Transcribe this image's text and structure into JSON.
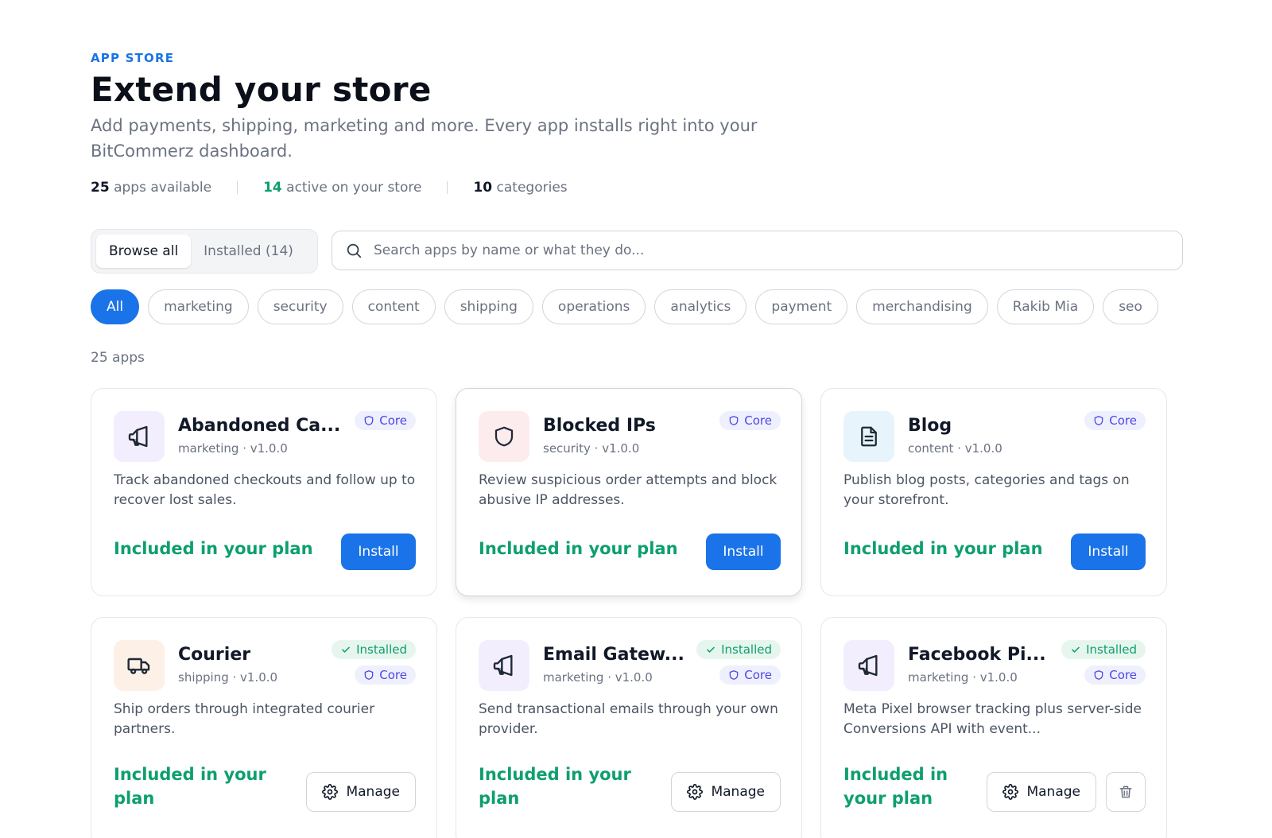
{
  "header": {
    "eyebrow": "APP STORE",
    "title": "Extend your store",
    "subtitle": "Add payments, shipping, marketing and more. Every app installs right into your BitCommerz dashboard."
  },
  "stats": [
    {
      "value": "25",
      "label": "apps available"
    },
    {
      "value": "14",
      "label": "active on your store"
    },
    {
      "value": "10",
      "label": "categories"
    }
  ],
  "tabs": [
    {
      "label": "Browse all",
      "active": true
    },
    {
      "label": "Installed (14)",
      "active": false
    }
  ],
  "search": {
    "placeholder": "Search apps by name or what they do..."
  },
  "filters": [
    "All",
    "marketing",
    "security",
    "content",
    "shipping",
    "operations",
    "analytics",
    "payment",
    "merchandising",
    "Rakib Mia",
    "seo"
  ],
  "results_count": "25 apps",
  "labels": {
    "core": "Core",
    "installed": "Installed",
    "install": "Install",
    "manage": "Manage",
    "plan": "Included in your plan"
  },
  "apps": [
    {
      "name": "Abandoned Ca...",
      "meta": "marketing · v1.0.0",
      "desc": "Track abandoned checkouts and follow up to recover lost sales.",
      "icon": "megaphone-icon"
    },
    {
      "name": "Blocked IPs",
      "meta": "security · v1.0.0",
      "desc": "Review suspicious order attempts and block abusive IP addresses.",
      "icon": "shield-icon"
    },
    {
      "name": "Blog",
      "meta": "content · v1.0.0",
      "desc": "Publish blog posts, categories and tags on your storefront.",
      "icon": "document-icon"
    },
    {
      "name": "Courier",
      "meta": "shipping · v1.0.0",
      "desc": "Ship orders through integrated courier partners.",
      "icon": "truck-icon"
    },
    {
      "name": "Email Gatew...",
      "meta": "marketing · v1.0.0",
      "desc": "Send transactional emails through your own provider.",
      "icon": "megaphone-icon"
    },
    {
      "name": "Facebook Pi...",
      "meta": "marketing · v1.0.0",
      "desc": "Meta Pixel browser tracking plus server-side Conversions API with event...",
      "icon": "megaphone-icon"
    }
  ],
  "colors": {
    "accent": "#1a73e8",
    "success": "#0e9f6e",
    "core": "#4f46e5"
  }
}
